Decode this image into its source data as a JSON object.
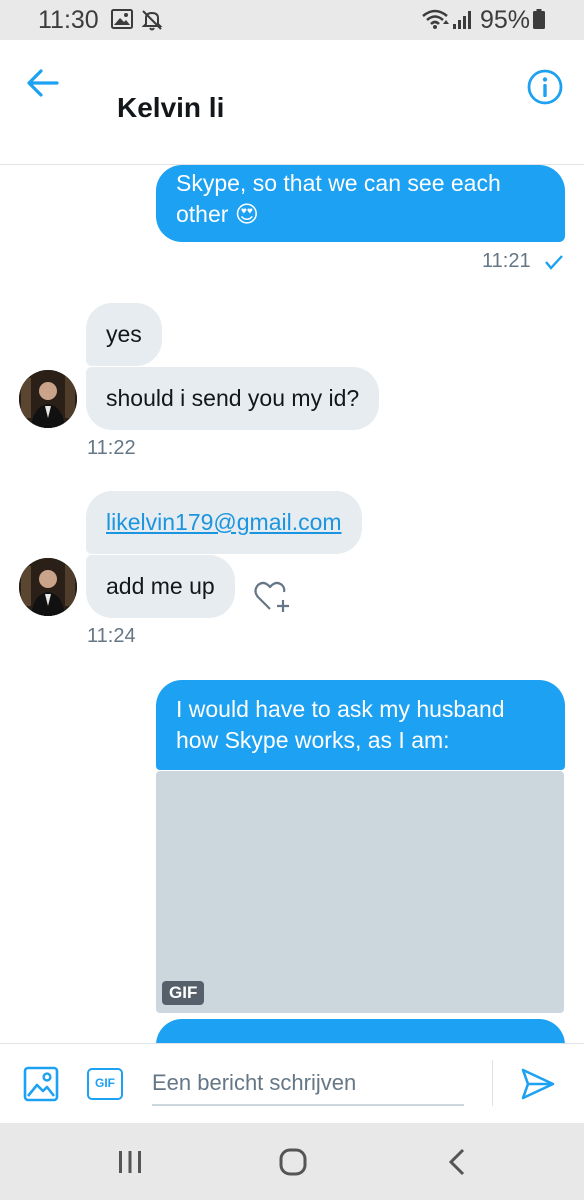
{
  "status_bar": {
    "time": "11:30",
    "battery": "95%",
    "icons": [
      "image-icon",
      "mute-icon",
      "wifi-icon",
      "signal-icon",
      "battery-icon"
    ]
  },
  "header": {
    "title": "Kelvin li",
    "back_icon": "arrow-left-icon",
    "info_icon": "info-icon",
    "accent_color": "#1da1f2"
  },
  "messages": [
    {
      "direction": "out",
      "text": "Skype, so that we can see each other 😍"
    },
    {
      "direction": "out",
      "time": "11:21",
      "status": "sent-check-icon"
    },
    {
      "direction": "in",
      "text": "yes"
    },
    {
      "direction": "in",
      "text": "should i send you my id?"
    },
    {
      "direction": "in",
      "time": "11:22"
    },
    {
      "direction": "in",
      "text": "likelvin179@gmail.com",
      "is_link": true
    },
    {
      "direction": "in",
      "text": "add me up",
      "reaction_icon": "heart-add-icon"
    },
    {
      "direction": "in",
      "time": "11:24"
    },
    {
      "direction": "out",
      "text": "I would have to ask my husband how Skype works, as I am:"
    },
    {
      "direction": "out",
      "attachment": "GIF"
    }
  ],
  "composer": {
    "placeholder": "Een bericht schrijven",
    "gif_label": "GIF",
    "icons": [
      "image-icon",
      "gif-icon",
      "send-icon"
    ]
  },
  "nav_bar": {
    "icons": [
      "recent-apps-icon",
      "home-icon",
      "back-icon"
    ]
  },
  "colors": {
    "outgoing_bubble": "#1da1f2",
    "incoming_bubble": "#e6ecf0",
    "timestamp": "#657786",
    "link": "#1b95e0"
  }
}
